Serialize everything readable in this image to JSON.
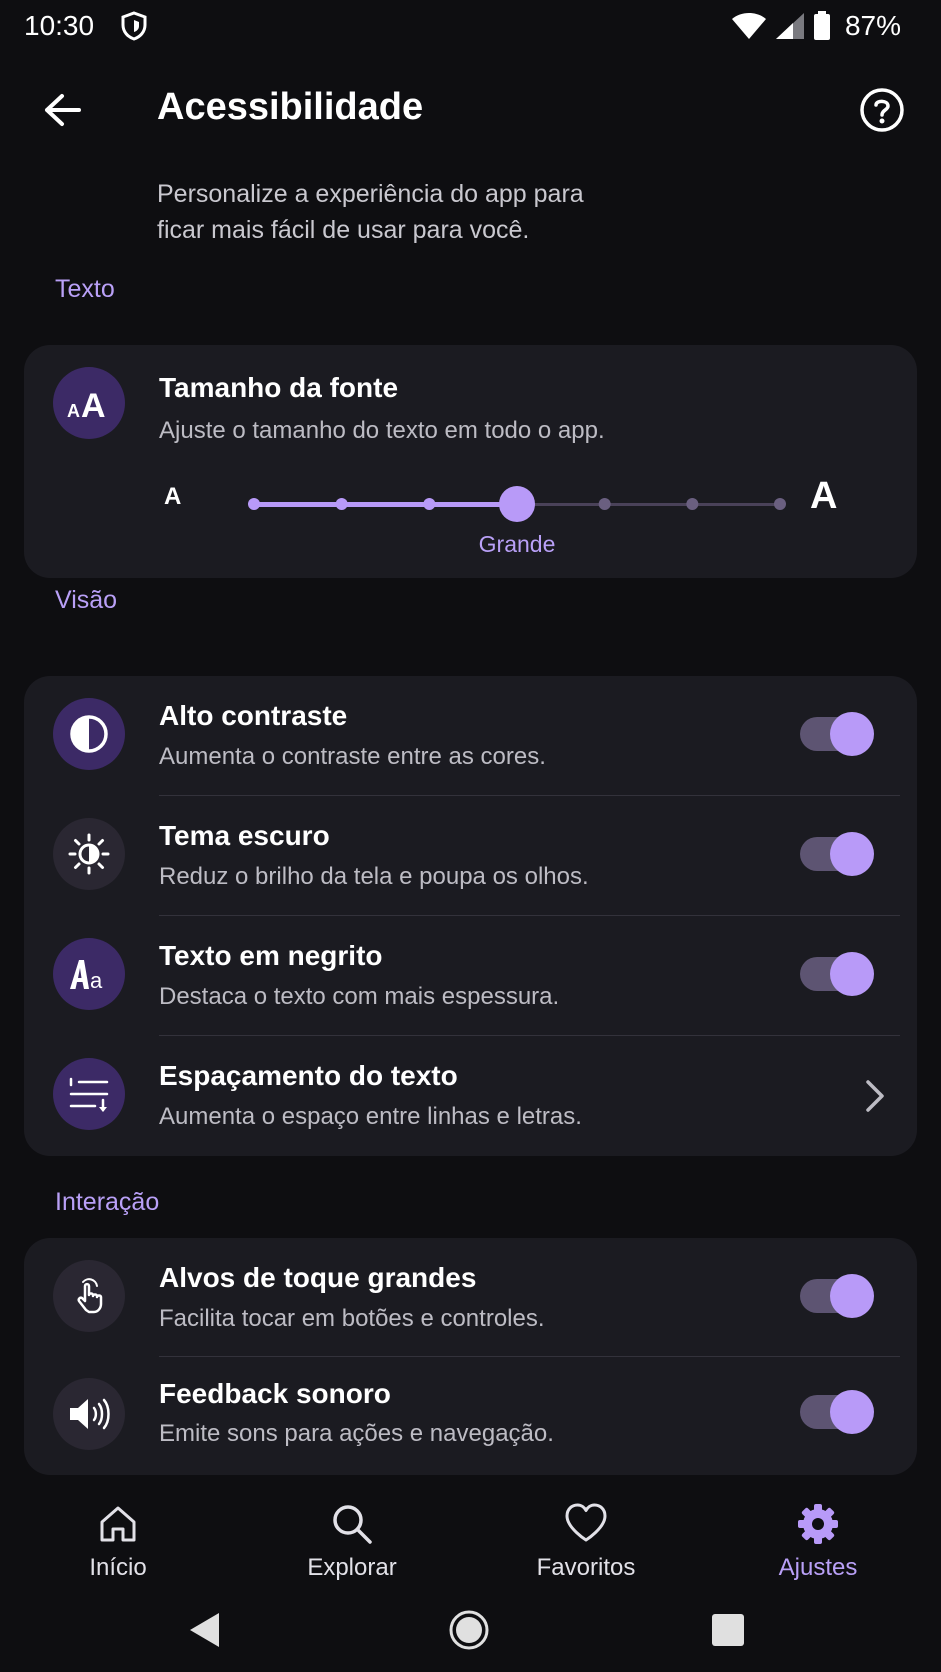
{
  "status": {
    "time": "10:30",
    "battery": "87%"
  },
  "header": {
    "title": "Acessibilidade"
  },
  "intro": {
    "line1": "Personalize a experiência do app para",
    "line2": "ficar mais fácil de usar para você."
  },
  "sections": {
    "texto": "Texto",
    "visao": "Visão",
    "interacao": "Interação"
  },
  "font_size": {
    "title": "Tamanho da fonte",
    "subtitle": "Ajuste o tamanho do texto em todo o app.",
    "small_label": "A",
    "large_label": "A",
    "value_label": "Grande",
    "steps": 7,
    "selected_index": 3
  },
  "vision": [
    {
      "title": "Alto contraste",
      "subtitle": "Aumenta o contraste entre as cores.",
      "enabled": true,
      "icon": "contrast-icon"
    },
    {
      "title": "Tema escuro",
      "subtitle": "Reduz o brilho da tela e poupa os olhos.",
      "enabled": true,
      "icon": "brightness-icon"
    },
    {
      "title": "Texto em negrito",
      "subtitle": "Destaca o texto com mais espessura.",
      "enabled": true,
      "icon": "bold-text-icon"
    },
    {
      "title": "Espaçamento do texto",
      "subtitle": "Aumenta o espaço entre linhas e letras.",
      "icon": "text-spacing-icon"
    }
  ],
  "interaction": [
    {
      "title": "Alvos de toque grandes",
      "subtitle": "Facilita tocar em botões e controles.",
      "enabled": true,
      "icon": "touch-icon"
    },
    {
      "title": "Feedback sonoro",
      "subtitle": "Emite sons para ações e navegação.",
      "enabled": true,
      "icon": "speaker-icon"
    }
  ],
  "nav": {
    "items": [
      {
        "label": "Início",
        "icon": "home-icon"
      },
      {
        "label": "Explorar",
        "icon": "search-icon"
      },
      {
        "label": "Favoritos",
        "icon": "heart-icon"
      },
      {
        "label": "Ajustes",
        "icon": "gear-icon"
      }
    ],
    "active": "Ajustes"
  },
  "colors": {
    "accent": "#b89af8",
    "background": "#0e0e11",
    "card": "#1b1b21",
    "icon_bg": "#3c2a66"
  }
}
